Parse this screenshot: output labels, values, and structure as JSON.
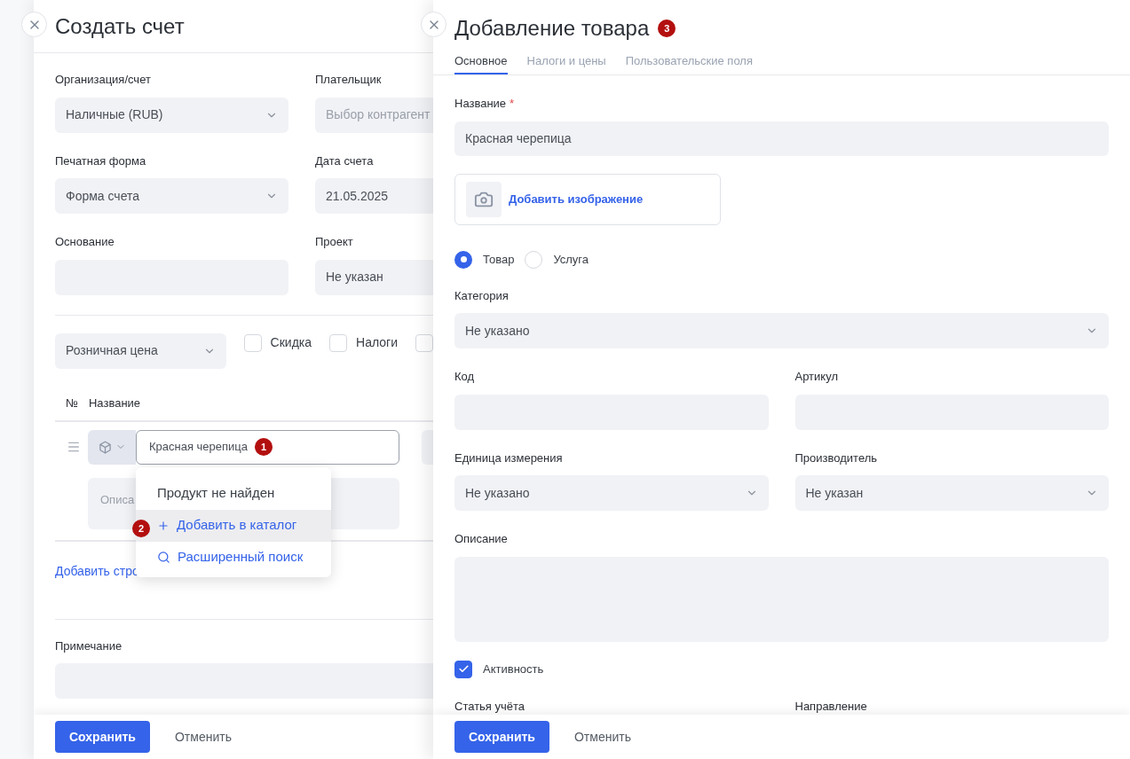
{
  "invoice_panel": {
    "title": "Создать счет",
    "fields": [
      {
        "label": "Организация/счет",
        "value": "Наличные (RUB)",
        "kind": "select"
      },
      {
        "label": "Плательщик",
        "placeholder": "Выбор контрагент",
        "kind": "text"
      },
      {
        "label": "Печатная форма",
        "value": "Форма счета",
        "kind": "select"
      },
      {
        "label": "Дата счета",
        "value": "21.05.2025",
        "kind": "text"
      },
      {
        "label": "Основание",
        "kind": "text"
      },
      {
        "label": "Проект",
        "value": "Не указан",
        "kind": "text"
      }
    ],
    "price_type": "Розничная цена",
    "options": [
      {
        "label": "Скидка",
        "checked": false
      },
      {
        "label": "Налоги",
        "checked": false
      },
      {
        "checked": false
      }
    ],
    "table": {
      "columns": [
        "№",
        "Название"
      ],
      "rows": [
        {
          "name": "Красная черепица",
          "marker": "1",
          "description_placeholder": "Описа"
        }
      ]
    },
    "dropdown": {
      "message": "Продукт не найден",
      "items": [
        {
          "label": "Добавить в каталог",
          "kind": "add",
          "marker": "2",
          "selected": true
        },
        {
          "label": "Расширенный поиск",
          "kind": "search",
          "selected": false
        }
      ]
    },
    "add_row_link": "Добавить стро",
    "note_label": "Примечание",
    "buttons": [
      "Сохранить",
      "Отменить"
    ]
  },
  "product_panel": {
    "title": "Добавление товара",
    "marker": "3",
    "tabs": [
      {
        "label": "Основное",
        "selected": true
      },
      {
        "label": "Налоги и цены",
        "selected": false
      },
      {
        "label": "Пользовательские поля",
        "selected": false
      }
    ],
    "name_field": {
      "label": "Название",
      "required_mark": "*",
      "value": "Красная черепица"
    },
    "image_button": "Добавить изображение",
    "product_type": [
      {
        "label": "Товар",
        "selected": true
      },
      {
        "label": "Услуга",
        "selected": false
      }
    ],
    "category": {
      "label": "Категория",
      "value": "Не указано",
      "kind": "select"
    },
    "field_rows": [
      [
        {
          "label": "Код",
          "kind": "text"
        },
        {
          "label": "Артикул",
          "kind": "text"
        }
      ],
      [
        {
          "label": "Единица измерения",
          "value": "Не указано",
          "kind": "select"
        },
        {
          "label": "Производитель",
          "value": "Не указан",
          "kind": "select"
        }
      ]
    ],
    "description_label": "Описание",
    "active": {
      "label": "Активность",
      "checked": true
    },
    "bottom_fields": [
      {
        "label": "Статья учёта"
      },
      {
        "label": "Направление"
      }
    ],
    "buttons": [
      "Сохранить",
      "Отменить"
    ]
  }
}
